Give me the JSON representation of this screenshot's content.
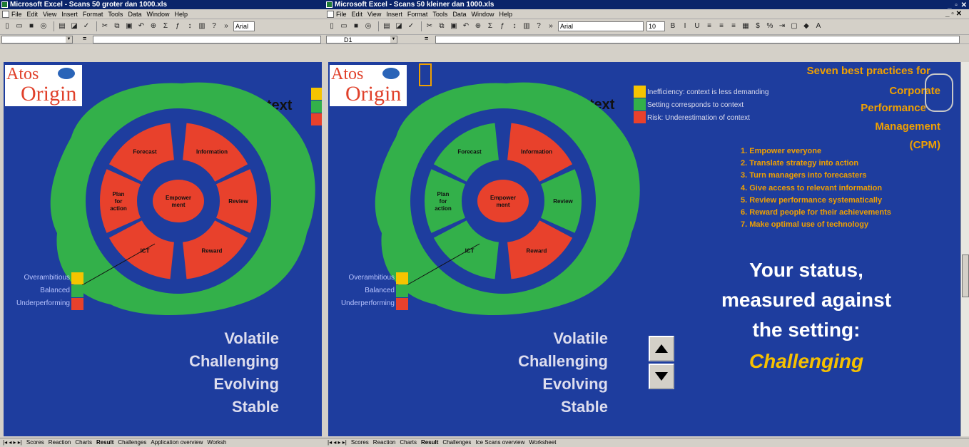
{
  "left": {
    "title": "Microsoft Excel - Scans 50 groter dan 1000.xls",
    "menu": [
      "File",
      "Edit",
      "View",
      "Insert",
      "Format",
      "Tools",
      "Data",
      "Window",
      "Help"
    ],
    "font": "Arial",
    "cell_ref": "",
    "context_label": "Context",
    "segments": {
      "forecast": "Forecast",
      "information": "Information",
      "plan": "Plan\nfor\naction",
      "empower": "Empower\nment",
      "review": "Review",
      "ict": "ICT",
      "reward": "Reward"
    },
    "legend": [
      "Overambitious",
      "Balanced",
      "Underperforming"
    ],
    "status_words": [
      "Volatile",
      "Challenging",
      "Evolving",
      "Stable"
    ],
    "tabs": [
      "Scores",
      "Reaction",
      "Charts",
      "Result",
      "Challenges",
      "Application overview",
      "Worksh"
    ]
  },
  "right": {
    "title": "Microsoft Excel - Scans 50 kleiner dan 1000.xls",
    "menu": [
      "File",
      "Edit",
      "View",
      "Insert",
      "Format",
      "Tools",
      "Data",
      "Window",
      "Help"
    ],
    "font": "Arial",
    "font_size": "10",
    "cell_ref": "D1",
    "context_label": "Context",
    "context_legend": [
      "Inefficiency: context is less demanding",
      "Setting corresponds to context",
      "Risk: Underestimation of context"
    ],
    "segments": {
      "forecast": "Forecast",
      "information": "Information",
      "plan": "Plan\nfor\naction",
      "empower": "Empower\nment",
      "review": "Review",
      "ict": "ICT",
      "reward": "Reward"
    },
    "legend": [
      "Overambitious",
      "Balanced",
      "Underperforming"
    ],
    "status_words": [
      "Volatile",
      "Challenging",
      "Evolving",
      "Stable"
    ],
    "bp_title": [
      "Seven best practices for",
      "Corporate",
      "Performance",
      "Management",
      "(CPM)"
    ],
    "bp_items": [
      "1. Empower everyone",
      "2. Translate strategy into action",
      "3. Turn managers into forecasters",
      "4. Give access to relevant information",
      "5. Review performance systematically",
      "6. Reward people for their achievements",
      "7. Make optimal use of technology"
    ],
    "status_lines": [
      "Your status,",
      "measured against",
      "the setting:"
    ],
    "status_value": "Challenging",
    "tabs": [
      "Scores",
      "Reaction",
      "Charts",
      "Result",
      "Challenges",
      "Ice Scans overview",
      "Worksheet"
    ]
  },
  "logo": {
    "line1": "Atos",
    "line2": "Origin"
  },
  "colors": {
    "sheet_bg": "#1e3d9e",
    "blob": "#33b04a",
    "red": "#e8412c",
    "green": "#33b04a",
    "yellow": "#f5c400",
    "accent": "#f0a000"
  }
}
